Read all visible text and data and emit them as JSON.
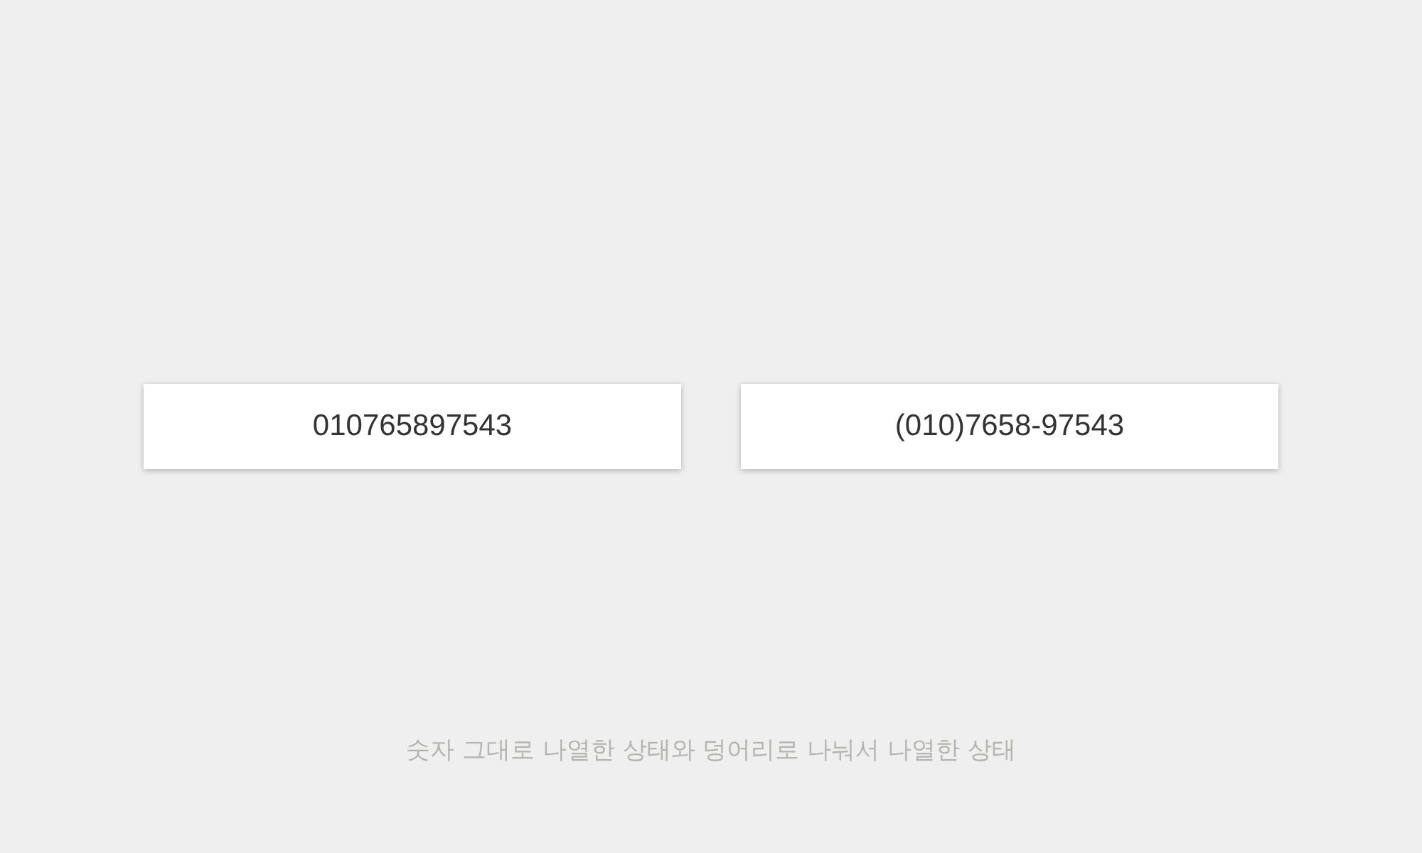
{
  "cards": [
    {
      "number": "010765897543"
    },
    {
      "number": "(010)7658-97543"
    }
  ],
  "caption": "숫자 그대로 나열한 상태와 덩어리로 나눠서 나열한 상태"
}
